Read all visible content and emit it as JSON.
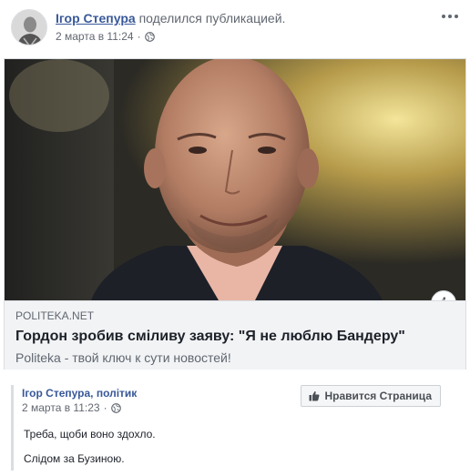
{
  "post": {
    "author": "Ігор Степура",
    "action": "поделился публикацией.",
    "timestamp": "2 марта в 11:24",
    "privacy_icon": "globe-icon",
    "more_icon": "more-options-icon"
  },
  "link_card": {
    "domain": "POLITEKA.NET",
    "title": "Гордон зробив сміливу заяву: \"Я не люблю Бандеру\"",
    "description": "Politeka - твой ключ к сути новостей!",
    "info_icon": "i"
  },
  "embedded_post": {
    "author": "Ігор Степура, політик",
    "timestamp": "2 марта в 11:23",
    "like_button_label": "Нравится Страница",
    "like_icon": "thumbs-up-icon",
    "text_lines": [
      "Треба, щоби воно здохло.",
      "Слідом за Бузиною."
    ]
  }
}
